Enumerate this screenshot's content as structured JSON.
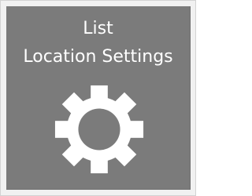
{
  "tile": {
    "title_line1": "List",
    "title_line2": "Location Settings",
    "icon": "gear-icon",
    "colors": {
      "tile_background": "#7b7b7b",
      "text": "#ffffff",
      "frame": "#f1f1f1"
    }
  }
}
